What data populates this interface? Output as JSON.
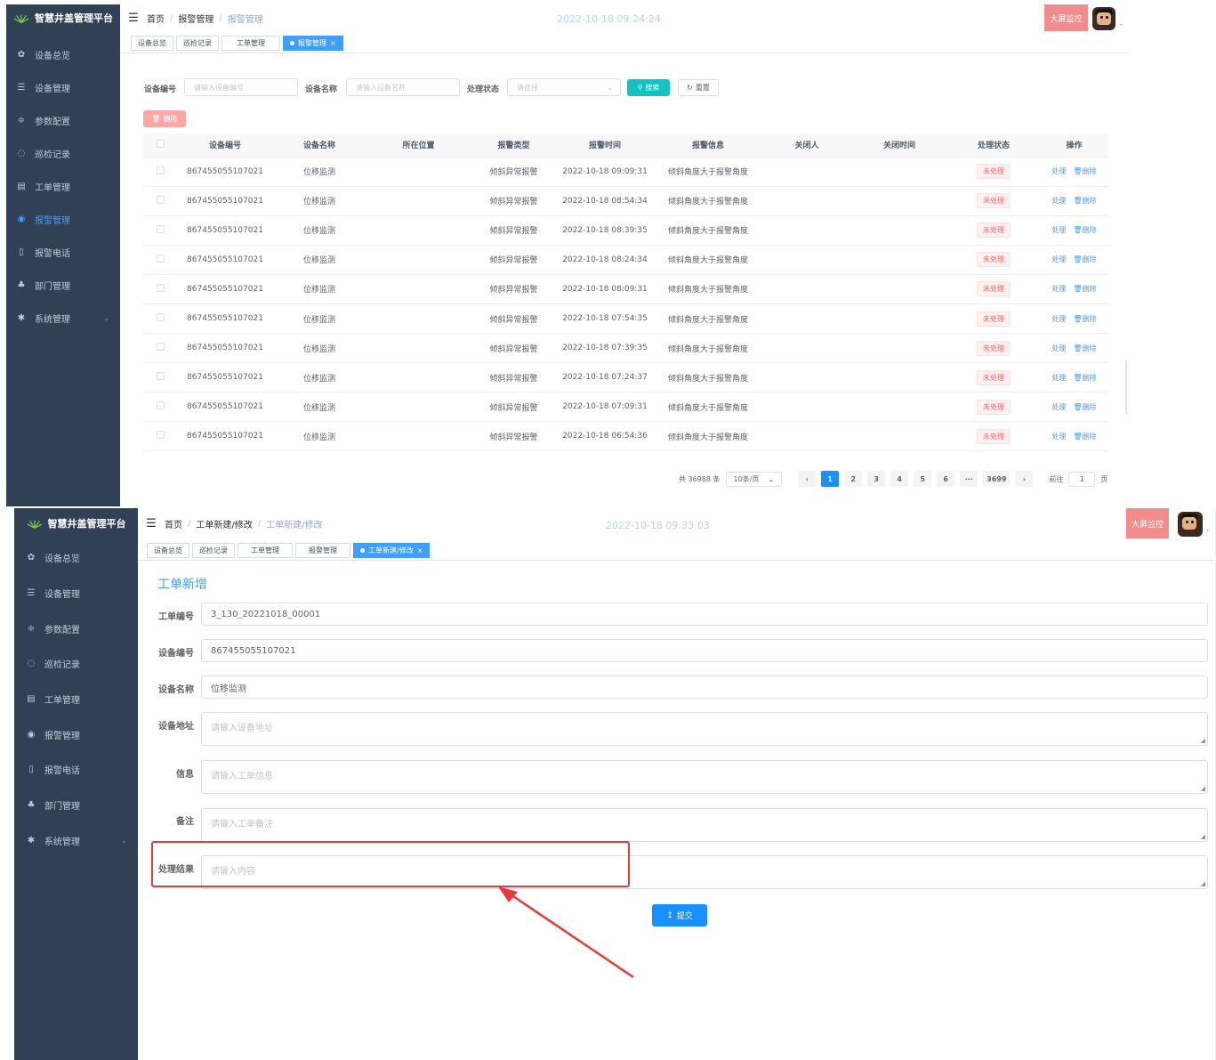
{
  "app": {
    "title": "智慧井盖管理平台"
  },
  "sidebar": {
    "items": [
      {
        "label": "设备总览",
        "icon": "dashboard-icon"
      },
      {
        "label": "设备管理",
        "icon": "list-icon"
      },
      {
        "label": "参数配置",
        "icon": "sliders-icon"
      },
      {
        "label": "巡检记录",
        "icon": "inspection-icon"
      },
      {
        "label": "工单管理",
        "icon": "table-icon"
      },
      {
        "label": "报警管理",
        "icon": "alarm-icon"
      },
      {
        "label": "报警电话",
        "icon": "phone-icon"
      },
      {
        "label": "部门管理",
        "icon": "tree-icon"
      },
      {
        "label": "系统管理",
        "icon": "gear-icon"
      }
    ]
  },
  "header1": {
    "crumbs": [
      "首页",
      "报警管理",
      "报警管理"
    ],
    "timestamp": "2022-10-18 09:24:24",
    "bigscreen": "大屏监控"
  },
  "tabs1": [
    "设备总览",
    "巡检记录",
    "工单管理",
    "报警管理"
  ],
  "search": {
    "device_no_label": "设备编号",
    "device_no_placeholder": "请输入设备编号",
    "device_name_label": "设备名称",
    "device_name_placeholder": "请输入设备名称",
    "status_label": "处理状态",
    "status_placeholder": "请选择",
    "search_btn": "搜索",
    "reset_btn": "重置",
    "delete_btn": "删除"
  },
  "table": {
    "columns": [
      "设备编号",
      "设备名称",
      "所在位置",
      "报警类型",
      "报警时间",
      "报警信息",
      "关闭人",
      "关闭时间",
      "处理状态",
      "操作"
    ],
    "op_handle": "处理",
    "op_delete": "删除",
    "rows": [
      {
        "device_no": "867455055107021",
        "name": "位移监测",
        "location": "",
        "type": "倾斜异常报警",
        "time": "2022-10-18 09:09:31",
        "info": "倾斜角度大于报警角度",
        "closer": "",
        "close_time": "",
        "status": "未处理"
      },
      {
        "device_no": "867455055107021",
        "name": "位移监测",
        "location": "",
        "type": "倾斜异常报警",
        "time": "2022-10-18 08:54:34",
        "info": "倾斜角度大于报警角度",
        "closer": "",
        "close_time": "",
        "status": "未处理"
      },
      {
        "device_no": "867455055107021",
        "name": "位移监测",
        "location": "",
        "type": "倾斜异常报警",
        "time": "2022-10-18 08:39:35",
        "info": "倾斜角度大于报警角度",
        "closer": "",
        "close_time": "",
        "status": "未处理"
      },
      {
        "device_no": "867455055107021",
        "name": "位移监测",
        "location": "",
        "type": "倾斜异常报警",
        "time": "2022-10-18 08:24:34",
        "info": "倾斜角度大于报警角度",
        "closer": "",
        "close_time": "",
        "status": "未处理"
      },
      {
        "device_no": "867455055107021",
        "name": "位移监测",
        "location": "",
        "type": "倾斜异常报警",
        "time": "2022-10-18 08:09:31",
        "info": "倾斜角度大于报警角度",
        "closer": "",
        "close_time": "",
        "status": "未处理"
      },
      {
        "device_no": "867455055107021",
        "name": "位移监测",
        "location": "",
        "type": "倾斜异常报警",
        "time": "2022-10-18 07:54:35",
        "info": "倾斜角度大于报警角度",
        "closer": "",
        "close_time": "",
        "status": "未处理"
      },
      {
        "device_no": "867455055107021",
        "name": "位移监测",
        "location": "",
        "type": "倾斜异常报警",
        "time": "2022-10-18 07:39:35",
        "info": "倾斜角度大于报警角度",
        "closer": "",
        "close_time": "",
        "status": "未处理"
      },
      {
        "device_no": "867455055107021",
        "name": "位移监测",
        "location": "",
        "type": "倾斜异常报警",
        "time": "2022-10-18 07:24:37",
        "info": "倾斜角度大于报警角度",
        "closer": "",
        "close_time": "",
        "status": "未处理"
      },
      {
        "device_no": "867455055107021",
        "name": "位移监测",
        "location": "",
        "type": "倾斜异常报警",
        "time": "2022-10-18 07:09:31",
        "info": "倾斜角度大于报警角度",
        "closer": "",
        "close_time": "",
        "status": "未处理"
      },
      {
        "device_no": "867455055107021",
        "name": "位移监测",
        "location": "",
        "type": "倾斜异常报警",
        "time": "2022-10-18 06:54:36",
        "info": "倾斜角度大于报警角度",
        "closer": "",
        "close_time": "",
        "status": "未处理"
      }
    ]
  },
  "pagination": {
    "total": "共 36988 条",
    "page_size": "10条/页",
    "pages": [
      "1",
      "2",
      "3",
      "4",
      "5",
      "6",
      "···",
      "3699"
    ],
    "current": "1",
    "goto_label": "前往",
    "goto_value": "1",
    "page_suffix": "页"
  },
  "header2": {
    "crumbs": [
      "首页",
      "工单新建/修改",
      "工单新建/修改"
    ],
    "timestamp": "2022-10-18 09:33:03",
    "bigscreen": "大屏监控"
  },
  "tabs2": [
    "设备总览",
    "巡检记录",
    "工单管理",
    "报警管理",
    "工单新建/修改"
  ],
  "workorder": {
    "title": "工单新增",
    "fields": {
      "order_no_label": "工单编号",
      "order_no_value": "3_130_20221018_00001",
      "device_no_label": "设备编号",
      "device_no_value": "867455055107021",
      "device_name_label": "设备名称",
      "device_name_value": "位移监测",
      "address_label": "设备地址",
      "address_placeholder": "请输入设备地址",
      "info_label": "信息",
      "info_placeholder": "请输入工单信息",
      "remark_label": "备注",
      "remark_placeholder": "请输入工单备注",
      "result_label": "处理结果",
      "result_placeholder": "请输入内容"
    },
    "submit": "提交"
  },
  "colors": {
    "sidebar_bg": "#304156",
    "primary": "#409eff",
    "danger": "#f56c6c",
    "annotation": "#e83a3a"
  }
}
